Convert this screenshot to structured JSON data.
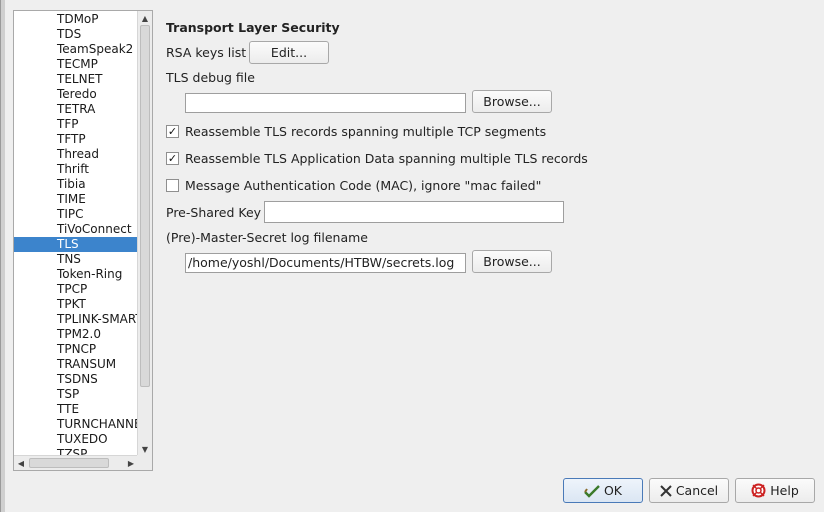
{
  "tree": {
    "items": [
      "TDMoP",
      "TDS",
      "TeamSpeak2",
      "TECMP",
      "TELNET",
      "Teredo",
      "TETRA",
      "TFP",
      "TFTP",
      "Thread",
      "Thrift",
      "Tibia",
      "TIME",
      "TIPC",
      "TiVoConnect",
      "TLS",
      "TNS",
      "Token-Ring",
      "TPCP",
      "TPKT",
      "TPLINK-SMARTHOME",
      "TPM2.0",
      "TPNCP",
      "TRANSUM",
      "TSDNS",
      "TSP",
      "TTE",
      "TURNCHANNEL",
      "TUXEDO",
      "TZSP"
    ],
    "selected": "TLS"
  },
  "tls": {
    "title": "Transport Layer Security",
    "rsa_keys_label": "RSA keys list",
    "edit_button": "Edit...",
    "debug_file_label": "TLS debug file",
    "debug_file_value": "",
    "browse_button": "Browse...",
    "reassemble_records_label": "Reassemble TLS records spanning multiple TCP segments",
    "reassemble_records_checked": true,
    "reassemble_appdata_label": "Reassemble TLS Application Data spanning multiple TLS records",
    "reassemble_appdata_checked": true,
    "mac_ignore_label": "Message Authentication Code (MAC), ignore \"mac failed\"",
    "mac_ignore_checked": false,
    "psk_label": "Pre-Shared Key",
    "psk_value": "",
    "master_secret_label": "(Pre)-Master-Secret log filename",
    "master_secret_value": "/home/yoshl/Documents/HTBW/secrets.log",
    "browse_button_2": "Browse..."
  },
  "footer": {
    "ok": "OK",
    "cancel": "Cancel",
    "help": "Help"
  },
  "colors": {
    "selection": "#3c84cc",
    "ok_border": "#4a7ab8"
  }
}
